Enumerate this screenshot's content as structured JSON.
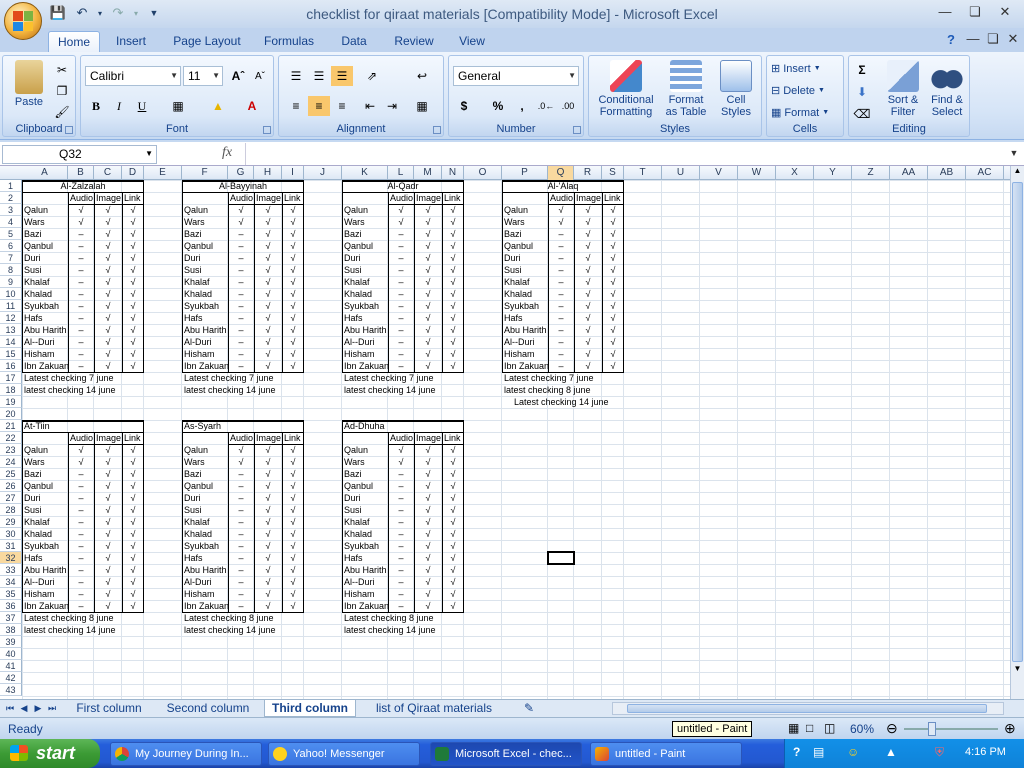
{
  "window": {
    "title": "checklist for qiraat materials  [Compatibility Mode] - Microsoft Excel"
  },
  "ribbon_tabs": [
    "Home",
    "Insert",
    "Page Layout",
    "Formulas",
    "Data",
    "Review",
    "View"
  ],
  "ribbon": {
    "clipboard": {
      "label": "Clipboard",
      "paste": "Paste"
    },
    "font": {
      "label": "Font",
      "name": "Calibri",
      "size": "11",
      "bold": "B",
      "italic": "I",
      "underline": "U"
    },
    "alignment": {
      "label": "Alignment"
    },
    "number": {
      "label": "Number",
      "format": "General",
      "currency": "$",
      "percent": "%",
      "comma": ","
    },
    "styles": {
      "label": "Styles",
      "conditional": "Conditional",
      "conditional2": "Formatting",
      "format_table": "Format",
      "format_table2": "as Table",
      "cell_styles": "Cell",
      "cell_styles2": "Styles"
    },
    "cells": {
      "label": "Cells",
      "insert": "Insert",
      "delete": "Delete",
      "format": "Format"
    },
    "editing": {
      "label": "Editing",
      "sort": "Sort &",
      "sort2": "Filter",
      "find": "Find &",
      "find2": "Select"
    }
  },
  "formula_bar": {
    "name_box": "Q32",
    "fx": "fx",
    "content": ""
  },
  "columns": [
    "A",
    "B",
    "C",
    "D",
    "E",
    "F",
    "G",
    "H",
    "I",
    "J",
    "K",
    "L",
    "M",
    "N",
    "O",
    "P",
    "Q",
    "R",
    "S",
    "T",
    "U",
    "V",
    "W",
    "X",
    "Y",
    "Z",
    "AA",
    "AB",
    "AC"
  ],
  "selected_col": "Q",
  "selected_row": 32,
  "rows_count": 43,
  "headers": {
    "audio": "Audio",
    "image": "Image",
    "link": "Link"
  },
  "marks": {
    "check": "√",
    "dash": "–"
  },
  "tables": [
    {
      "title": "Al-Zalzalah",
      "names": [
        "Qalun",
        "Wars",
        "Bazi",
        "Qanbul",
        "Duri",
        "Susi",
        "Khalaf",
        "Khalad",
        "Syukbah",
        "Hafs",
        "Abu Harith",
        "Al--Duri",
        "Hisham",
        "Ibn Zakuan"
      ],
      "notes": [
        "Latest checking 7 june",
        "latest checking 14 june"
      ]
    },
    {
      "title": "Al-Bayyinah",
      "names": [
        "Qalun",
        "Wars",
        "Bazi",
        "Qanbul",
        "Duri",
        "Susi",
        "Khalaf",
        "Khalad",
        "Syukbah",
        "Hafs",
        "Abu Harith",
        "Al-Duri",
        "Hisham",
        "Ibn Zakuan"
      ],
      "notes": [
        "Latest checking 7 june",
        "latest checking 14 june"
      ]
    },
    {
      "title": "Al-Qadr",
      "names": [
        "Qalun",
        "Wars",
        "Bazi",
        "Qanbul",
        "Duri",
        "Susi",
        "Khalaf",
        "Khalad",
        "Syukbah",
        "Hafs",
        "Abu Harith",
        "Al--Duri",
        "Hisham",
        "Ibn Zakuan"
      ],
      "notes": [
        "Latest checking 7 june",
        "latest checking 14 june"
      ]
    },
    {
      "title": "Al-'Alaq",
      "names": [
        "Qalun",
        "Wars",
        "Bazi",
        "Qanbul",
        "Duri",
        "Susi",
        "Khalaf",
        "Khalad",
        "Syukbah",
        "Hafs",
        "Abu Harith",
        "Al--Duri",
        "Hisham",
        "Ibn Zakuan"
      ],
      "notes": [
        "Latest checking 7 june",
        "latest checking 8 june",
        "Latest checking 14 june"
      ]
    },
    {
      "title": "At-Tiin",
      "names": [
        "Qalun",
        "Wars",
        "Bazi",
        "Qanbul",
        "Duri",
        "Susi",
        "Khalaf",
        "Khalad",
        "Syukbah",
        "Hafs",
        "Abu Harith",
        "Al--Duri",
        "Hisham",
        "Ibn Zakuan"
      ],
      "notes": [
        "Latest checking 8 june",
        "latest checking 14 june"
      ]
    },
    {
      "title": "As-Syarh",
      "names": [
        "Qalun",
        "Wars",
        "Bazi",
        "Qanbul",
        "Duri",
        "Susi",
        "Khalaf",
        "Khalad",
        "Syukbah",
        "Hafs",
        "Abu Harith",
        "Al-Duri",
        "Hisham",
        "Ibn Zakuan"
      ],
      "notes": [
        "Latest checking 8 june",
        "latest checking 14 june"
      ]
    },
    {
      "title": "Ad-Dhuha",
      "names": [
        "Qalun",
        "Wars",
        "Bazi",
        "Qanbul",
        "Duri",
        "Susi",
        "Khalaf",
        "Khalad",
        "Syukbah",
        "Hafs",
        "Abu Harith",
        "Al--Duri",
        "Hisham",
        "Ibn Zakuan"
      ],
      "notes": [
        "Latest checking 8 june",
        "latest checking 14 june"
      ]
    }
  ],
  "sheet_tabs": [
    "First column",
    "Second column",
    "Third column",
    "list of Qiraat materials"
  ],
  "active_sheet": "Third column",
  "status": {
    "ready": "Ready",
    "zoom": "60%",
    "tooltip": "untitled - Paint"
  },
  "taskbar": {
    "start": "start",
    "tasks": [
      "My Journey During In...",
      "Yahoo! Messenger",
      "Microsoft Excel - chec...",
      "untitled - Paint"
    ],
    "clock": "4:16 PM"
  }
}
